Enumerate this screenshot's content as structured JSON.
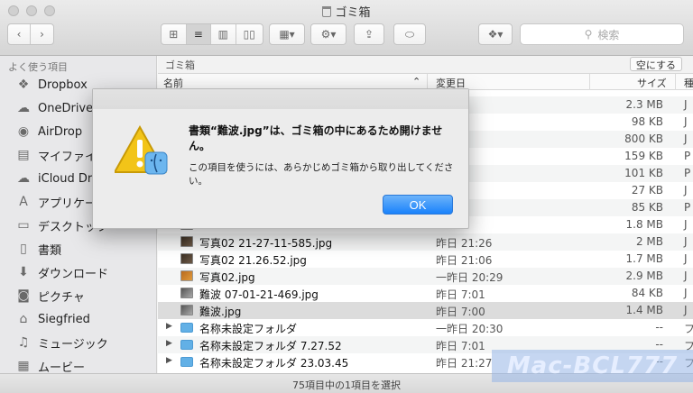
{
  "window": {
    "title": "ゴミ箱"
  },
  "toolbar": {
    "search_placeholder": "検索"
  },
  "sidebar": {
    "header": "よく使う項目",
    "items": [
      {
        "label": "Dropbox",
        "icon": "dropbox-icon"
      },
      {
        "label": "OneDrive",
        "icon": "cloud-icon"
      },
      {
        "label": "AirDrop",
        "icon": "airdrop-icon"
      },
      {
        "label": "マイファイル",
        "icon": "all-files-icon"
      },
      {
        "label": "iCloud Drive",
        "icon": "icloud-icon"
      },
      {
        "label": "アプリケーション",
        "icon": "applications-icon"
      },
      {
        "label": "デスクトップ",
        "icon": "desktop-icon"
      },
      {
        "label": "書類",
        "icon": "documents-icon"
      },
      {
        "label": "ダウンロード",
        "icon": "downloads-icon"
      },
      {
        "label": "ピクチャ",
        "icon": "pictures-icon"
      },
      {
        "label": "Siegfried",
        "icon": "home-icon"
      },
      {
        "label": "ミュージック",
        "icon": "music-icon"
      },
      {
        "label": "ムービー",
        "icon": "movies-icon"
      }
    ]
  },
  "pathbar": {
    "title": "ゴミ箱",
    "empty_button": "空にする"
  },
  "columns": {
    "name": "名前",
    "modified": "変更日",
    "size": "サイズ",
    "kind": "種"
  },
  "files": [
    {
      "name": "",
      "date": "20:29",
      "size": "2.3 MB",
      "kind": "J",
      "icon": "img",
      "disclosure": false
    },
    {
      "name": "",
      "date": ":47",
      "size": "98 KB",
      "kind": "J",
      "icon": "img",
      "disclosure": false
    },
    {
      "name": "",
      "date": ":05",
      "size": "800 KB",
      "kind": "J",
      "icon": "img",
      "disclosure": false
    },
    {
      "name": "",
      "date": "2:48",
      "size": "159 KB",
      "kind": "P",
      "icon": "img",
      "disclosure": false
    },
    {
      "name": "",
      "date": "2:49",
      "size": "101 KB",
      "kind": "P",
      "icon": "img",
      "disclosure": false
    },
    {
      "name": "",
      "date": "15:52",
      "size": "27 KB",
      "kind": "J",
      "icon": "img",
      "disclosure": false
    },
    {
      "name": "",
      "date": "22:15",
      "size": "85 KB",
      "kind": "P",
      "icon": "img",
      "disclosure": false
    },
    {
      "name": "",
      "date": ":05",
      "size": "1.8 MB",
      "kind": "J",
      "icon": "img",
      "disclosure": false
    },
    {
      "name": "写真02 21-27-11-585.jpg",
      "date": "昨日 21:26",
      "size": "2 MB",
      "kind": "J",
      "icon": "img",
      "disclosure": false
    },
    {
      "name": "写真02 21.26.52.jpg",
      "date": "昨日 21:06",
      "size": "1.7 MB",
      "kind": "J",
      "icon": "img",
      "disclosure": false
    },
    {
      "name": "写真02.jpg",
      "date": "一昨日 20:29",
      "size": "2.9 MB",
      "kind": "J",
      "icon": "img2",
      "disclosure": false
    },
    {
      "name": "難波 07-01-21-469.jpg",
      "date": "昨日 7:01",
      "size": "84 KB",
      "kind": "J",
      "icon": "img3",
      "disclosure": false
    },
    {
      "name": "難波.jpg",
      "date": "昨日 7:00",
      "size": "1.4 MB",
      "kind": "J",
      "icon": "img3",
      "disclosure": false,
      "selected": true
    },
    {
      "name": "名称未設定フォルダ",
      "date": "一昨日 20:30",
      "size": "--",
      "kind": "フ",
      "icon": "folder",
      "disclosure": true
    },
    {
      "name": "名称未設定フォルダ 7.27.52",
      "date": "昨日 7:01",
      "size": "--",
      "kind": "フ",
      "icon": "folder",
      "disclosure": true
    },
    {
      "name": "名称未設定フォルダ 23.03.45",
      "date": "昨日 21:27",
      "size": "--",
      "kind": "フ",
      "icon": "folder",
      "disclosure": true
    }
  ],
  "status": {
    "text": "75項目中の1項目を選択"
  },
  "alert": {
    "title": "書類“難波.jpg”は、ゴミ箱の中にあるため開けません。",
    "message": "この項目を使うには、あらかじめゴミ箱から取り出してください。",
    "ok_label": "OK"
  },
  "watermark": "Mac-BCL777"
}
